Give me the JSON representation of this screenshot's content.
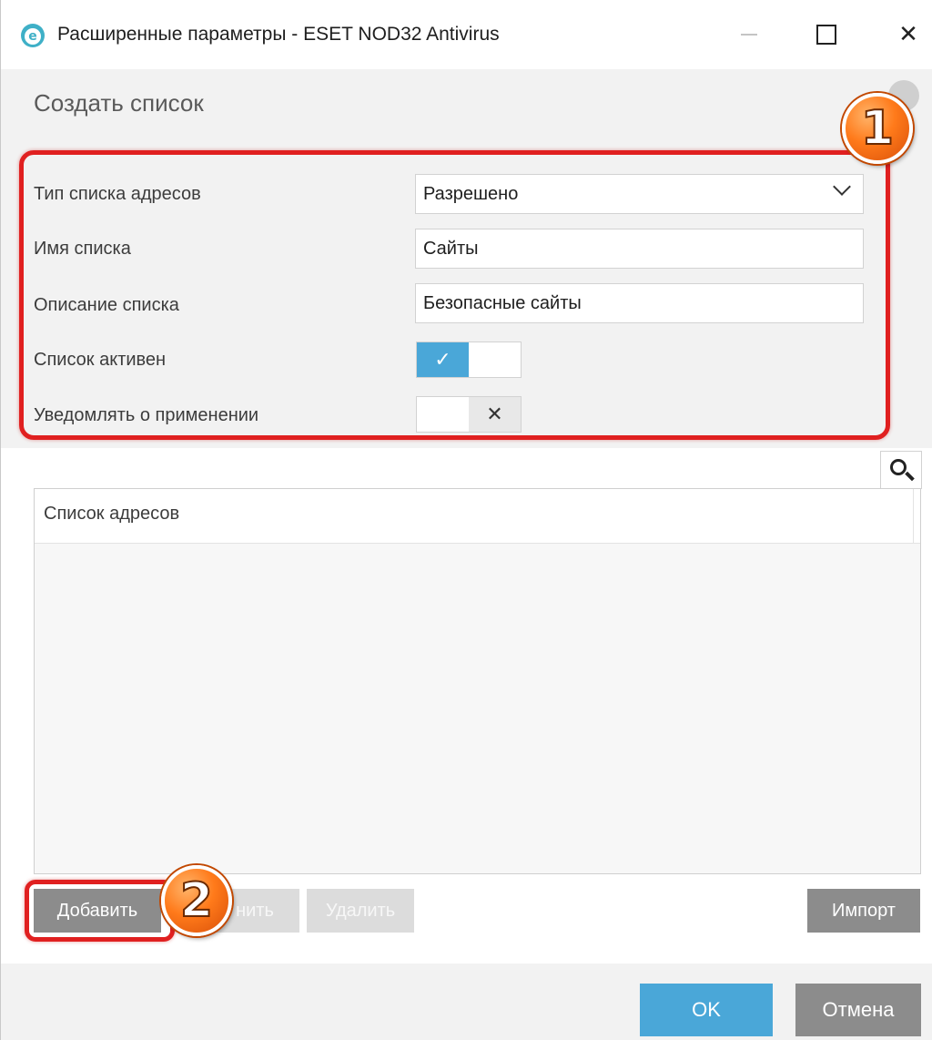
{
  "window": {
    "title": "Расширенные параметры - ESET NOD32 Antivirus",
    "app_icon_letter": "e"
  },
  "header": {
    "title": "Создать список"
  },
  "form": {
    "type_label": "Тип списка адресов",
    "type_value": "Разрешено",
    "name_label": "Имя списка",
    "name_value": "Сайты",
    "desc_label": "Описание списка",
    "desc_value": "Безопасные сайты",
    "active_label": "Список активен",
    "active_on": true,
    "active_glyph": "✓",
    "notify_label": "Уведомлять о применении",
    "notify_on": false,
    "notify_glyph": "✕"
  },
  "list": {
    "column_header": "Список адресов"
  },
  "list_buttons": {
    "add": "Добавить",
    "edit": "нить",
    "delete": "Удалить",
    "import": "Импорт"
  },
  "footer": {
    "ok": "OK",
    "cancel": "Отмена"
  },
  "annotations": {
    "badge1": "1",
    "badge2": "2"
  },
  "colors": {
    "accent_blue": "#4aa7d8",
    "callout_red": "#e02020",
    "badge_orange": "#ff7a1a",
    "gray_button": "#8c8c8c"
  }
}
